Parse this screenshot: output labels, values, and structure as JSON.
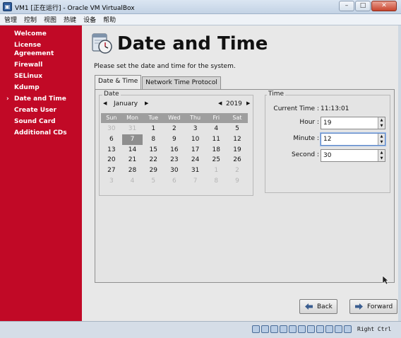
{
  "window": {
    "title": "VM1 [正在运行] - Oracle VM VirtualBox",
    "app_icon": "virtualbox-icon",
    "controls": [
      "minimize",
      "maximize",
      "close"
    ]
  },
  "menubar": {
    "items": [
      "管理",
      "控制",
      "视图",
      "热键",
      "设备",
      "帮助"
    ]
  },
  "sidebar": {
    "items": [
      {
        "label": "Welcome",
        "current": false
      },
      {
        "label": "License Agreement",
        "current": false
      },
      {
        "label": "Firewall",
        "current": false
      },
      {
        "label": "SELinux",
        "current": false
      },
      {
        "label": "Kdump",
        "current": false
      },
      {
        "label": "Date and Time",
        "current": true
      },
      {
        "label": "Create User",
        "current": false
      },
      {
        "label": "Sound Card",
        "current": false
      },
      {
        "label": "Additional CDs",
        "current": false
      }
    ],
    "current_marker": "›"
  },
  "header": {
    "icon": "clock-calendar-icon",
    "title": "Date and Time",
    "subtitle": "Please set the date and time for the system."
  },
  "tabs": [
    {
      "label": "Date & Time",
      "active": true
    },
    {
      "label": "Network Time Protocol",
      "active": false
    }
  ],
  "date": {
    "group_label": "Date",
    "month": "January",
    "year": "2019",
    "weekdays": [
      "Sun",
      "Mon",
      "Tue",
      "Wed",
      "Thu",
      "Fri",
      "Sat"
    ],
    "days": [
      {
        "d": "30",
        "other": true
      },
      {
        "d": "31",
        "other": true
      },
      {
        "d": "1"
      },
      {
        "d": "2"
      },
      {
        "d": "3"
      },
      {
        "d": "4"
      },
      {
        "d": "5"
      },
      {
        "d": "6"
      },
      {
        "d": "7",
        "selected": true
      },
      {
        "d": "8"
      },
      {
        "d": "9"
      },
      {
        "d": "10"
      },
      {
        "d": "11"
      },
      {
        "d": "12"
      },
      {
        "d": "13"
      },
      {
        "d": "14"
      },
      {
        "d": "15"
      },
      {
        "d": "16"
      },
      {
        "d": "17"
      },
      {
        "d": "18"
      },
      {
        "d": "19"
      },
      {
        "d": "20"
      },
      {
        "d": "21"
      },
      {
        "d": "22"
      },
      {
        "d": "23"
      },
      {
        "d": "24"
      },
      {
        "d": "25"
      },
      {
        "d": "26"
      },
      {
        "d": "27"
      },
      {
        "d": "28"
      },
      {
        "d": "29"
      },
      {
        "d": "30"
      },
      {
        "d": "31"
      },
      {
        "d": "1",
        "other": true
      },
      {
        "d": "2",
        "other": true
      },
      {
        "d": "3",
        "other": true
      },
      {
        "d": "4",
        "other": true
      },
      {
        "d": "5",
        "other": true
      },
      {
        "d": "6",
        "other": true
      },
      {
        "d": "7",
        "other": true
      },
      {
        "d": "8",
        "other": true
      },
      {
        "d": "9",
        "other": true
      }
    ]
  },
  "time": {
    "group_label": "Time",
    "current_label": "Current Time :",
    "current_value": "11:13:01",
    "hour_label": "Hour :",
    "hour_value": "19",
    "minute_label": "Minute :",
    "minute_value": "12",
    "second_label": "Second :",
    "second_value": "30"
  },
  "buttons": {
    "back": "Back",
    "forward": "Forward"
  },
  "statusbar": {
    "host_key": "Right Ctrl"
  }
}
